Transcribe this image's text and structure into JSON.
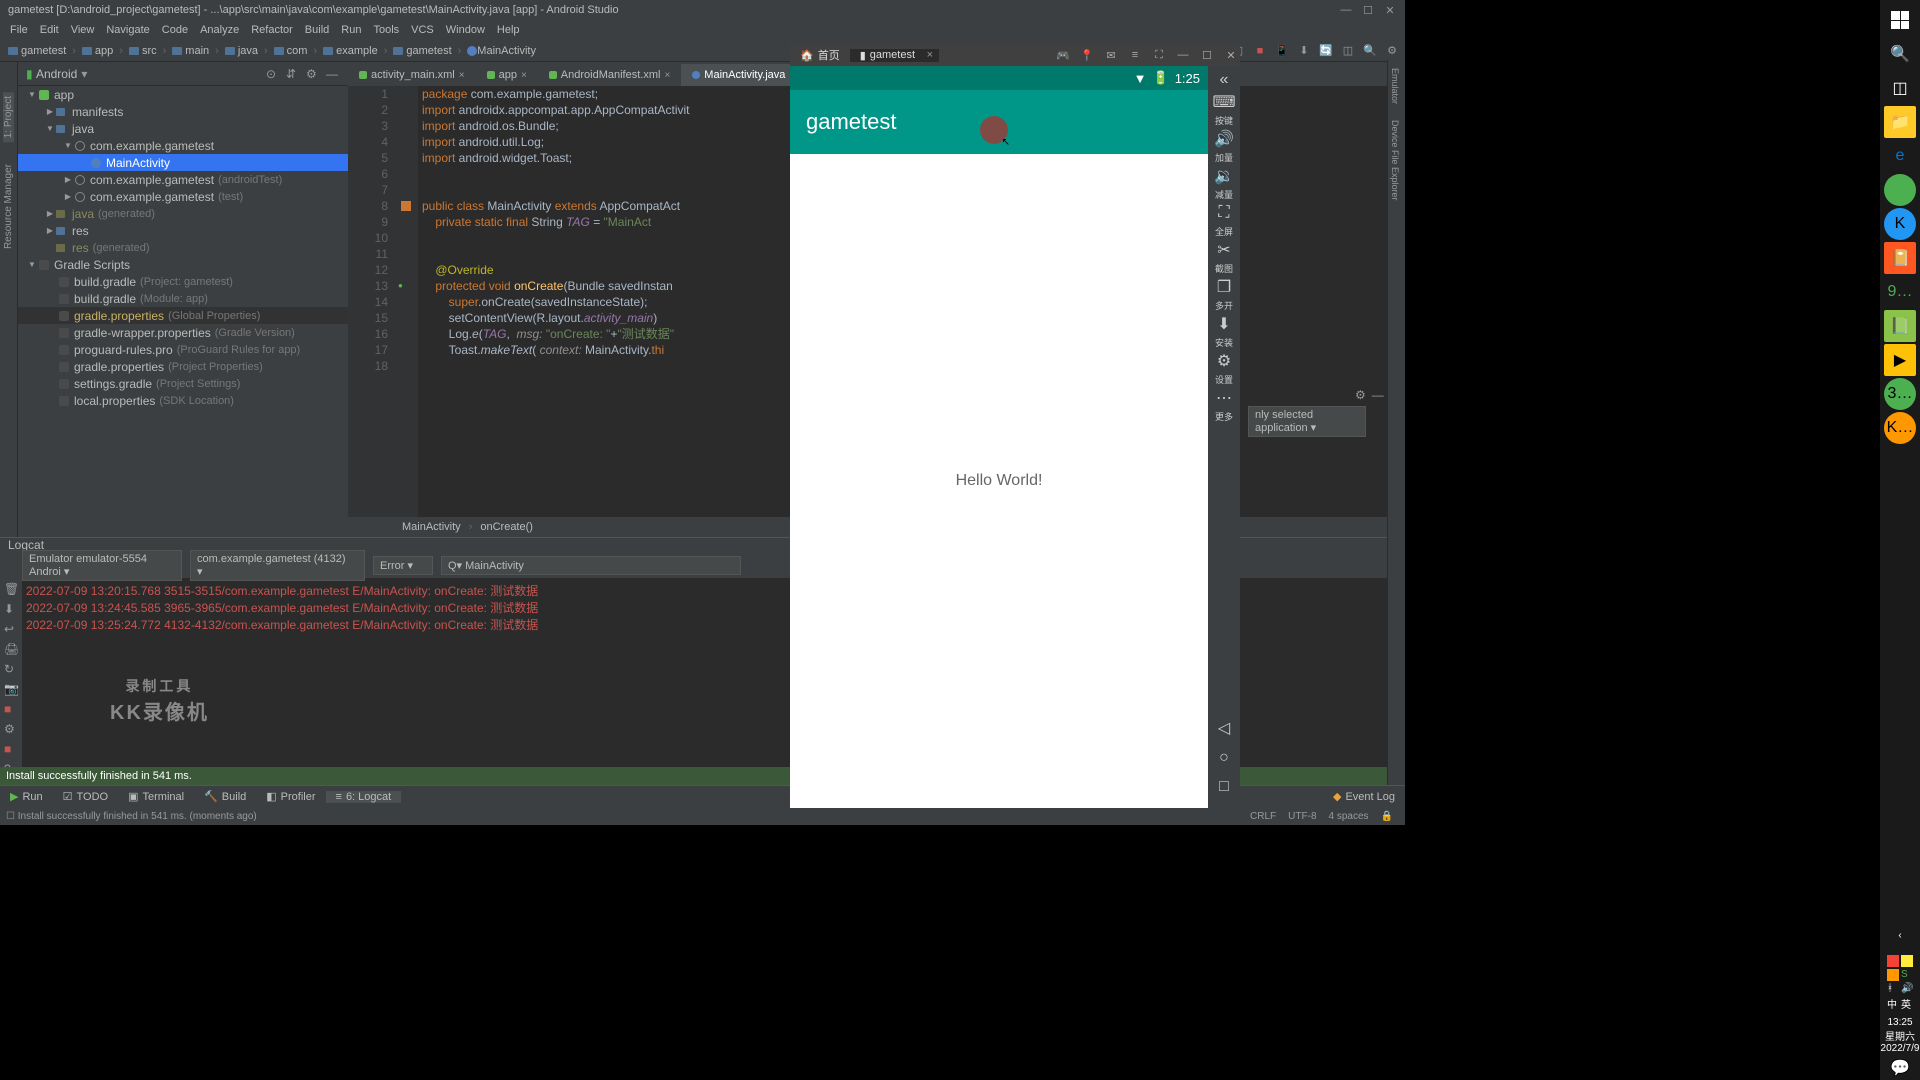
{
  "window_title": "gametest [D:\\android_project\\gametest] - ...\\app\\src\\main\\java\\com\\example\\gametest\\MainActivity.java [app] - Android Studio",
  "menu": [
    "File",
    "Edit",
    "View",
    "Navigate",
    "Code",
    "Analyze",
    "Refactor",
    "Build",
    "Run",
    "Tools",
    "VCS",
    "Window",
    "Help"
  ],
  "breadcrumbs": [
    "gametest",
    "app",
    "src",
    "main",
    "java",
    "com",
    "example",
    "gametest",
    "MainActivity"
  ],
  "project_header": "Android",
  "tree": {
    "app": "app",
    "manifests": "manifests",
    "java": "java",
    "pkg1": "com.example.gametest",
    "main_activity": "MainActivity",
    "pkg2": "com.example.gametest",
    "pkg2_dim": "(androidTest)",
    "pkg3": "com.example.gametest",
    "pkg3_dim": "(test)",
    "java_gen": "java",
    "java_gen_dim": "(generated)",
    "res": "res",
    "res_gen": "res",
    "res_gen_dim": "(generated)",
    "gradle_scripts": "Gradle Scripts",
    "bg1": "build.gradle",
    "bg1_dim": "(Project: gametest)",
    "bg2": "build.gradle",
    "bg2_dim": "(Module: app)",
    "gp1": "gradle.properties",
    "gp1_dim": "(Global Properties)",
    "gw": "gradle-wrapper.properties",
    "gw_dim": "(Gradle Version)",
    "pg": "proguard-rules.pro",
    "pg_dim": "(ProGuard Rules for app)",
    "gp2": "gradle.properties",
    "gp2_dim": "(Project Properties)",
    "sg": "settings.gradle",
    "sg_dim": "(Project Settings)",
    "lp": "local.properties",
    "lp_dim": "(SDK Location)"
  },
  "editor_tabs": [
    {
      "name": "activity_main.xml"
    },
    {
      "name": "app"
    },
    {
      "name": "AndroidManifest.xml"
    },
    {
      "name": "MainActivity.java"
    }
  ],
  "line_numbers": [
    1,
    2,
    3,
    4,
    5,
    6,
    7,
    8,
    9,
    10,
    11,
    12,
    13,
    14,
    15,
    16,
    17,
    18
  ],
  "code_nav": {
    "class": "MainActivity",
    "method": "onCreate()"
  },
  "logcat": {
    "title": "Logcat",
    "device": "Emulator emulator-5554 Androi",
    "process": "com.example.gametest (4132)",
    "level": "Error",
    "search": "MainActivity",
    "search_prefix": "Q▾",
    "right_filter": "nly selected application",
    "settings_icon": "gear",
    "lines": [
      "2022-07-09 13:20:15.768 3515-3515/com.example.gametest E/MainActivity: onCreate: 测试数据",
      "2022-07-09 13:24:45.585 3965-3965/com.example.gametest E/MainActivity: onCreate: 测试数据",
      "2022-07-09 13:25:24.772 4132-4132/com.example.gametest E/MainActivity: onCreate: 测试数据"
    ]
  },
  "watermark": {
    "l1": "录制工具",
    "l2": "KK录像机"
  },
  "success_msg": "Install successfully finished in 541 ms.",
  "bottom_tabs": {
    "run": "Run",
    "todo": "TODO",
    "terminal": "Terminal",
    "build": "Build",
    "profiler": "Profiler",
    "logcat": "6: Logcat",
    "event_log": "Event Log"
  },
  "status_bar_msg": "Install successfully finished in 541 ms. (moments ago)",
  "status_right": {
    "crlf": "CRLF",
    "enc": "UTF-8",
    "indent": "4 spaces"
  },
  "emulator": {
    "home_tab": "首页",
    "app_tab": "gametest",
    "status_time": "1:25",
    "app_title": "gametest",
    "body_text": "Hello World!",
    "side": [
      "按键",
      "加量",
      "减量",
      "全屏",
      "截图",
      "多开",
      "安装",
      "设置",
      "更多"
    ]
  },
  "taskbar": {
    "time": "13:25",
    "day": "星期六",
    "date": "2022/7/9"
  },
  "right_gutter": [
    "Device File Explorer",
    "Emulator"
  ]
}
